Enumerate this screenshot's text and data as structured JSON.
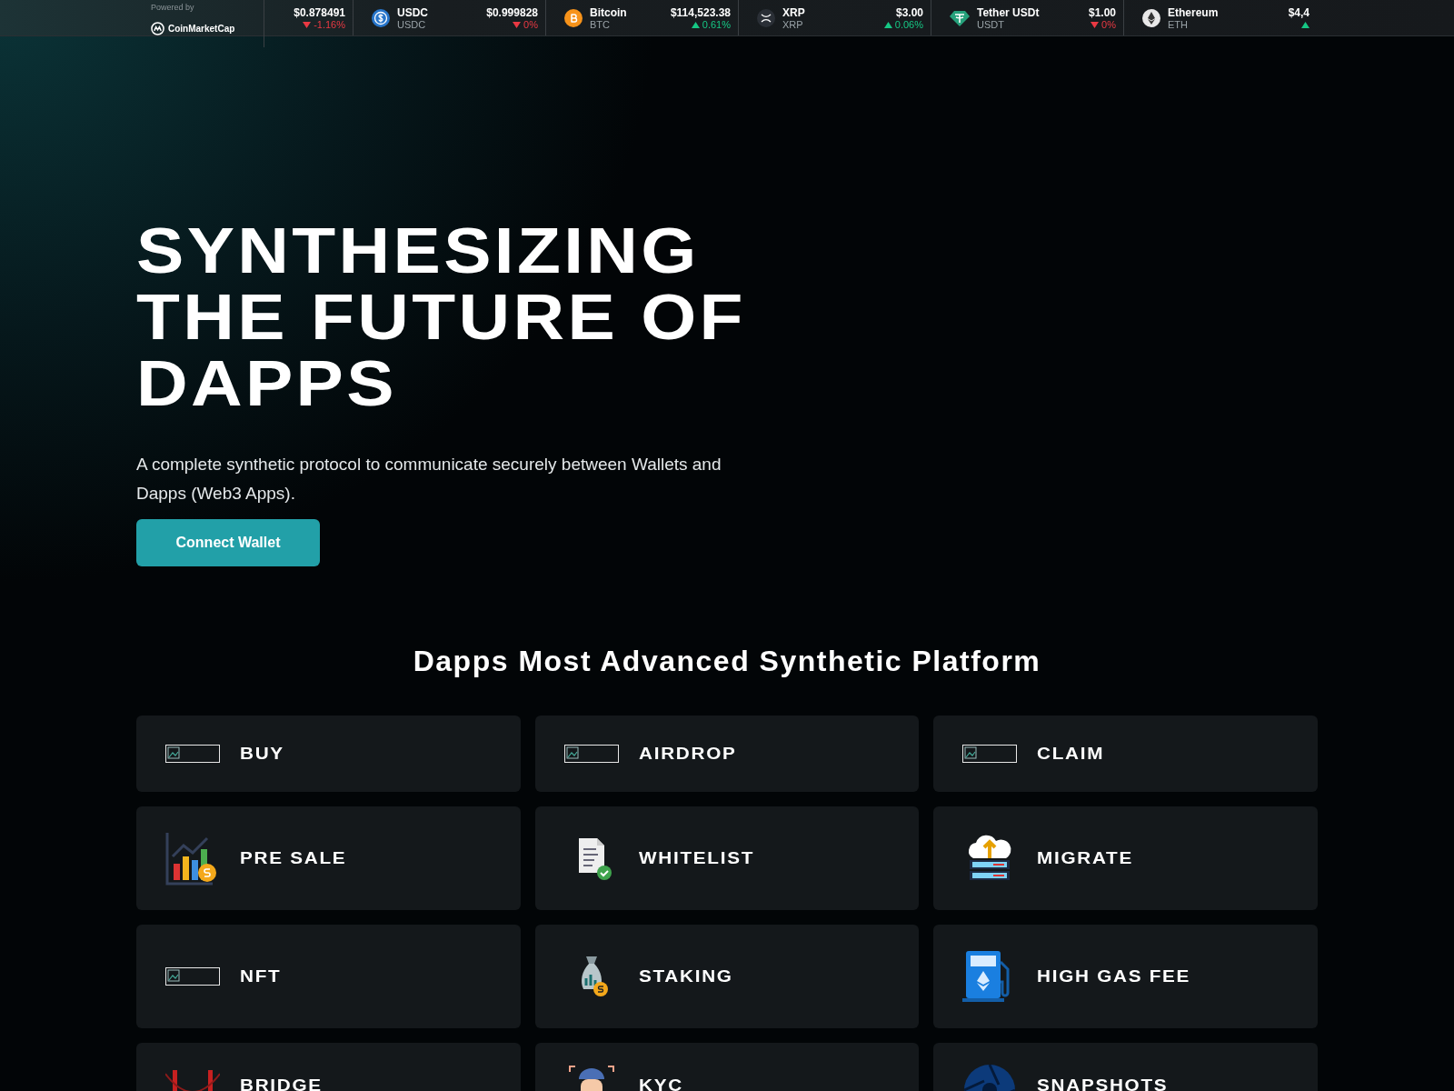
{
  "ticker": {
    "powered_by": "Powered by",
    "brand": "CoinMarketCap",
    "items": [
      {
        "kind": "partial",
        "price": "$0.878491",
        "change": "-1.16%",
        "up": false
      },
      {
        "kind": "coin",
        "name": "USDC",
        "symbol": "USDC",
        "price": "$0.999828",
        "change": "0%",
        "up": false
      },
      {
        "kind": "coin",
        "name": "Bitcoin",
        "symbol": "BTC",
        "price": "$114,523.38",
        "change": "0.61%",
        "up": true
      },
      {
        "kind": "coin",
        "name": "XRP",
        "symbol": "XRP",
        "price": "$3.00",
        "change": "0.06%",
        "up": true
      },
      {
        "kind": "coin",
        "name": "Tether USDt",
        "symbol": "USDT",
        "price": "$1.00",
        "change": "0%",
        "up": false
      },
      {
        "kind": "coin",
        "name": "Ethereum",
        "symbol": "ETH",
        "price": "$4,4",
        "up": true
      }
    ]
  },
  "hero": {
    "title_lines": [
      "SYNTHESIZING",
      "THE FUTURE OF",
      "DAPPS"
    ],
    "subtitle": "A complete synthetic protocol to communicate securely between Wallets and Dapps (Web3 Apps).",
    "button": "Connect Wallet"
  },
  "section_title": "Dapps Most Advanced Synthetic Platform",
  "cards": [
    {
      "label": "BUY"
    },
    {
      "label": "AIRDROP"
    },
    {
      "label": "CLAIM"
    },
    {
      "label": "PRE SALE"
    },
    {
      "label": "WHITELIST"
    },
    {
      "label": "MIGRATE"
    },
    {
      "label": "NFT"
    },
    {
      "label": "STAKING"
    },
    {
      "label": "HIGH GAS FEE"
    },
    {
      "label": "BRIDGE"
    },
    {
      "label": "KYC"
    },
    {
      "label": "SNAPSHOTS"
    }
  ]
}
